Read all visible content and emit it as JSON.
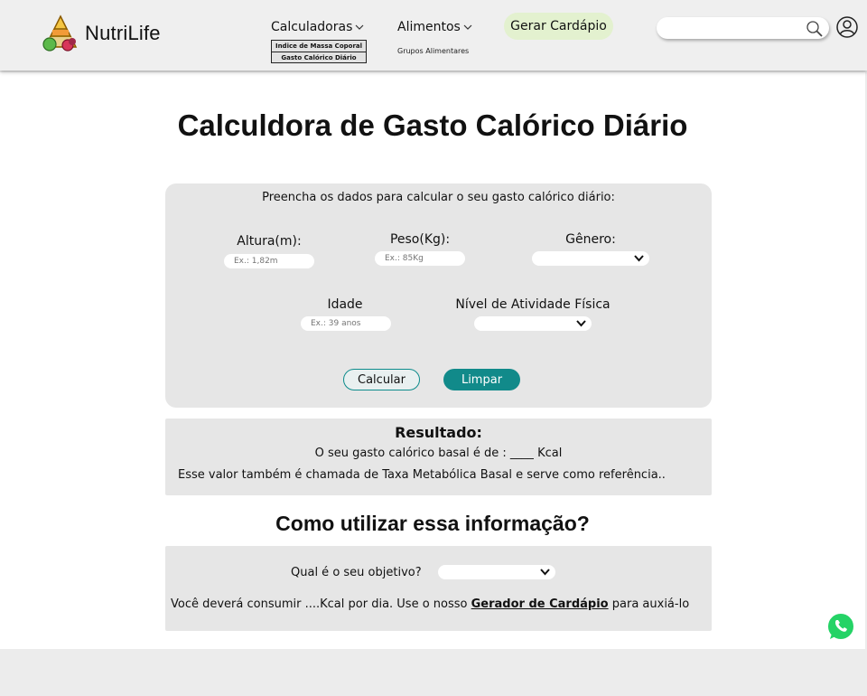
{
  "brand": {
    "name": "NutriLife",
    "logo_icon": "food-pyramid-logo"
  },
  "nav": {
    "calculators_label": "Calculadoras",
    "calculators_sub": [
      "Indice de Massa Coporal",
      "Gasto Calórico Diário"
    ],
    "foods_label": "Alimentos",
    "foods_sub": "Grupos Alimentares",
    "menu_button": "Gerar Cardápio"
  },
  "search": {
    "placeholder": "",
    "icon": "search-icon"
  },
  "page": {
    "title": "Calculdora de Gasto Calórico Diário"
  },
  "form": {
    "intro": "Preencha os dados para calcular o seu gasto calórico diário:",
    "height_label": "Altura(m):",
    "height_placeholder": "Ex.: 1,82m",
    "weight_label": "Peso(Kg):",
    "weight_placeholder": "Ex.: 85Kg",
    "gender_label": "Gênero:",
    "age_label": "Idade",
    "age_placeholder": "Ex.: 39 anos",
    "activity_label": "Nível de Atividade Física",
    "calc_button": "Calcular",
    "clear_button": "Limpar"
  },
  "result": {
    "heading": "Resultado:",
    "line1": "O seu gasto calórico basal é de : ____ Kcal",
    "line2": "Esse valor também é chamada de Taxa Metabólica Basal  e serve como referência.."
  },
  "usage": {
    "heading": "Como utilizar essa informação?",
    "question": "Qual é o seu objetivo?",
    "text_before": "Você deverá consumir ....Kcal por dia.  Use o nosso ",
    "link": "Gerador de Cardápio",
    "text_after": " para auxiá-lo"
  },
  "colors": {
    "accent": "#118a8a",
    "menu_button_bg": "#e3f1cf",
    "panel": "#e6e6e6",
    "whatsapp": "#25d366"
  }
}
